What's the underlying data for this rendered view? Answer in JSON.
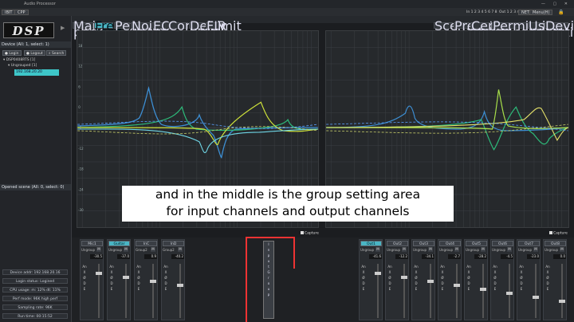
{
  "window": {
    "title": "Audio Processor",
    "controls": "— ▢ ✕"
  },
  "menubar": {
    "items": [
      "IBIT",
      "CPP"
    ],
    "ch_label": "In",
    "in_nums": [
      "1",
      "2",
      "3",
      "4",
      "5",
      "6",
      "7",
      "8"
    ],
    "out_label": "Out",
    "out_nums": [
      "1",
      "2",
      "3",
      "4",
      "5",
      "6",
      "7",
      "8"
    ],
    "right_buttons": [
      "NET",
      "Menu(H)"
    ]
  },
  "left": {
    "logo": "DSP",
    "device_header": "Device (All: 1, select: 1)",
    "buttons": [
      "Login",
      "Logout",
      "Search"
    ],
    "tree": {
      "device": "DSP0408RTS [1]",
      "group": "Ungrouped [1]",
      "ip": "192.168.20.20"
    },
    "opened_header": "Opened scene (All: 0, select: 0)",
    "info": [
      "Device addr: 192.168.20.16",
      "Login status: Logined",
      "CPU usage: m: 12% dt: 11%",
      "Perf mode: 96K high perf",
      "Sampling rate: 96K",
      "Run time: 00:15:52"
    ]
  },
  "tabs": {
    "left": [
      "Main page",
      "Freq resp",
      "Pext",
      "Noise gate",
      "EQ",
      "Comp/Limit",
      "Delay",
      "FIR"
    ],
    "right": [
      "Scene",
      "Preset",
      "Center ctrl",
      "Permission manage",
      "User",
      "Device setting"
    ],
    "active": "Freq resp"
  },
  "graph_left": {
    "channels": [
      "Mic1",
      "Guitar",
      "InC",
      "InD"
    ],
    "checks": [
      "All in",
      "Mag",
      "Phase"
    ],
    "y_ticks_left": [
      "18",
      "12",
      "6",
      "0",
      "-6",
      "-12",
      "-18",
      "-24",
      "-30"
    ],
    "y_ticks_right": [
      "180",
      "120",
      "60",
      "0",
      "-60",
      "-120",
      "-180"
    ]
  },
  "graph_right": {
    "channels": [
      "Out1",
      "Out2",
      "Out3",
      "Out4",
      "Out5",
      "Out6",
      "Out7",
      "Out8"
    ],
    "checks": [
      "All out",
      "Mag",
      "Phase"
    ]
  },
  "caption": {
    "line1": "and in the middle is the group setting area",
    "line2": "for input channels and output channels"
  },
  "capture_label": "Capture",
  "group_area": [
    "I",
    "n",
    "p",
    "u",
    "t",
    "",
    "G",
    "r",
    "o",
    "u",
    "p"
  ],
  "in_strips": [
    {
      "name": "Mic1",
      "group": "Ungroup",
      "val": "-30.5"
    },
    {
      "name": "Guitar",
      "group": "Ungroup",
      "val": "-37.0"
    },
    {
      "name": "InC",
      "group": "Group2",
      "val": "0.9"
    },
    {
      "name": "InD",
      "group": "Group2",
      "val": "-40.2"
    }
  ],
  "out_strips": [
    {
      "name": "Out1",
      "group": "Ungroup",
      "val": "-41.6"
    },
    {
      "name": "Out2",
      "group": "Ungroup",
      "val": "-12.2"
    },
    {
      "name": "Out3",
      "group": "Ungroup",
      "val": "-34.1"
    },
    {
      "name": "Out4",
      "group": "Ungroup",
      "val": "-2.7"
    },
    {
      "name": "Out5",
      "group": "Ungroup",
      "val": "-28.2"
    },
    {
      "name": "Out6",
      "group": "Ungroup",
      "val": "-4.5"
    },
    {
      "name": "Out7",
      "group": "Ungroup",
      "val": "-23.0"
    },
    {
      "name": "Out8",
      "group": "Ungroup",
      "val": "0.0"
    }
  ],
  "strip_labels": [
    "M",
    "An",
    "X",
    "Ø",
    "D",
    "E"
  ],
  "colors": {
    "accent": "#4ab5c4",
    "annotation": "#e33333"
  }
}
